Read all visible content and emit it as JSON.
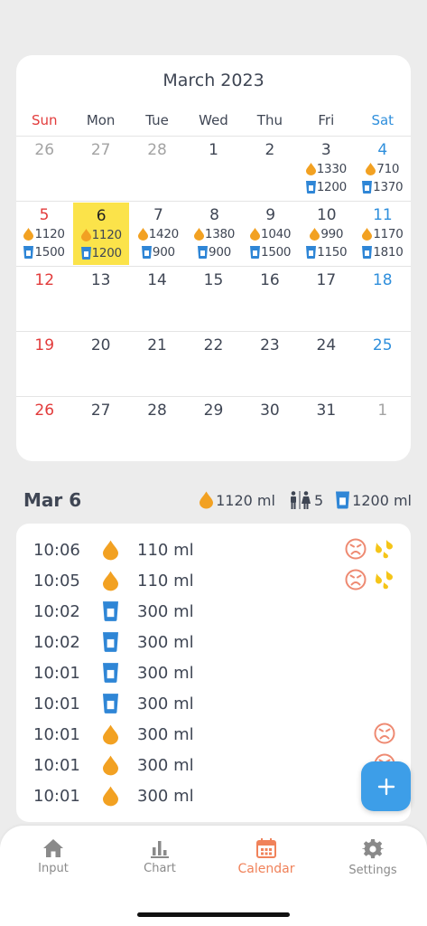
{
  "calendar": {
    "title": "March 2023",
    "weekdays": [
      "Sun",
      "Mon",
      "Tue",
      "Wed",
      "Thu",
      "Fri",
      "Sat"
    ],
    "weeks": [
      [
        {
          "day": "26"
        },
        {
          "day": "27"
        },
        {
          "day": "28"
        },
        {
          "day": "1"
        },
        {
          "day": "2"
        },
        {
          "day": "3",
          "voided": "1330",
          "intake": "1200"
        },
        {
          "day": "4",
          "voided": "710",
          "intake": "1370"
        }
      ],
      [
        {
          "day": "5",
          "voided": "1120",
          "intake": "1500"
        },
        {
          "day": "6",
          "voided": "1120",
          "intake": "1200"
        },
        {
          "day": "7",
          "voided": "1420",
          "intake": "900"
        },
        {
          "day": "8",
          "voided": "1380",
          "intake": "900"
        },
        {
          "day": "9",
          "voided": "1040",
          "intake": "1500"
        },
        {
          "day": "10",
          "voided": "990",
          "intake": "1150"
        },
        {
          "day": "11",
          "voided": "1170",
          "intake": "1810"
        }
      ],
      [
        {
          "day": "12"
        },
        {
          "day": "13"
        },
        {
          "day": "14"
        },
        {
          "day": "15"
        },
        {
          "day": "16"
        },
        {
          "day": "17"
        },
        {
          "day": "18"
        }
      ],
      [
        {
          "day": "19"
        },
        {
          "day": "20"
        },
        {
          "day": "21"
        },
        {
          "day": "22"
        },
        {
          "day": "23"
        },
        {
          "day": "24"
        },
        {
          "day": "25"
        }
      ],
      [
        {
          "day": "26"
        },
        {
          "day": "27"
        },
        {
          "day": "28"
        },
        {
          "day": "29"
        },
        {
          "day": "30"
        },
        {
          "day": "31"
        },
        {
          "day": "1"
        }
      ]
    ]
  },
  "summary": {
    "date": "Mar 6",
    "voided": "1120 ml",
    "toilet_count": "5",
    "intake": "1200 ml"
  },
  "log": [
    {
      "time": "10:06",
      "type": "void",
      "amount": "110 ml",
      "urge": true,
      "leak": true
    },
    {
      "time": "10:05",
      "type": "void",
      "amount": "110 ml",
      "urge": true,
      "leak": true
    },
    {
      "time": "10:02",
      "type": "drink",
      "amount": "300 ml"
    },
    {
      "time": "10:02",
      "type": "drink",
      "amount": "300 ml"
    },
    {
      "time": "10:01",
      "type": "drink",
      "amount": "300 ml"
    },
    {
      "time": "10:01",
      "type": "drink",
      "amount": "300 ml"
    },
    {
      "time": "10:01",
      "type": "void",
      "amount": "300 ml",
      "urge": true
    },
    {
      "time": "10:01",
      "type": "void",
      "amount": "300 ml",
      "urge": true
    },
    {
      "time": "10:01",
      "type": "void",
      "amount": "300 ml"
    }
  ],
  "tabs": [
    {
      "label": "Input",
      "icon": "home-icon"
    },
    {
      "label": "Chart",
      "icon": "bar-chart-icon"
    },
    {
      "label": "Calendar",
      "icon": "calendar-icon",
      "active": true
    },
    {
      "label": "Settings",
      "icon": "gear-icon"
    }
  ],
  "colors": {
    "void": "#f2a122",
    "drink": "#2f86d6",
    "today_highlight": "#fbe34a",
    "sunday": "#e23b3b",
    "saturday": "#2f8fdc",
    "accent": "#f0825a",
    "fab": "#3d9ee8"
  }
}
